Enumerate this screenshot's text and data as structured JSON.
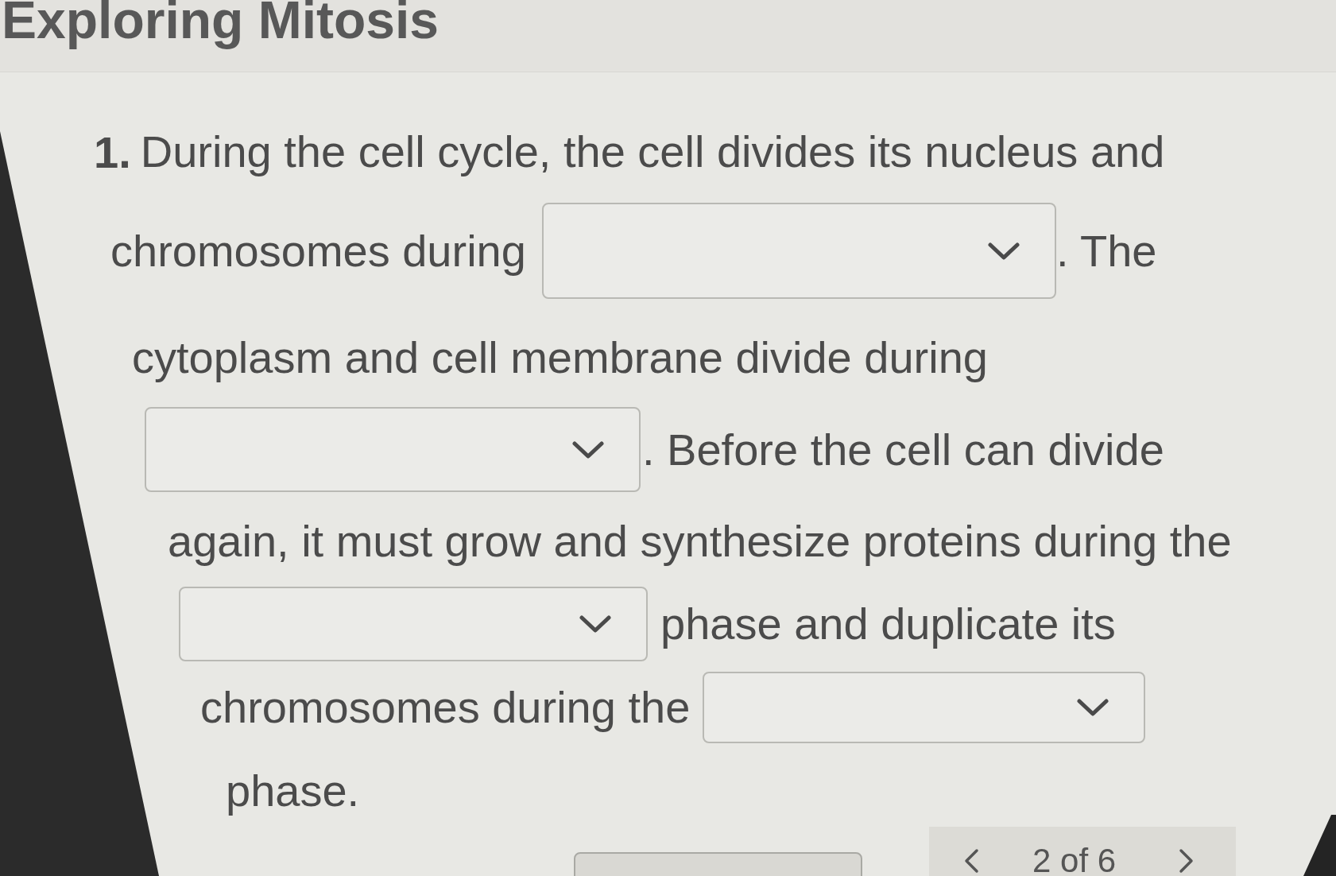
{
  "header": {
    "title": "Exploring Mitosis"
  },
  "question": {
    "number": "1.",
    "lines": [
      [
        {
          "kind": "text",
          "text": "During the cell cycle, the cell divides its nucleus and"
        }
      ],
      [
        {
          "kind": "text",
          "text": "chromosomes during"
        },
        {
          "kind": "dropdown"
        },
        {
          "kind": "text",
          "text": ". The"
        }
      ],
      [
        {
          "kind": "text",
          "text": "cytoplasm and cell membrane divide during"
        }
      ],
      [
        {
          "kind": "dropdown"
        },
        {
          "kind": "text",
          "text": ". Before the cell can divide"
        }
      ],
      [
        {
          "kind": "text",
          "text": "again, it must grow and synthesize proteins during the"
        }
      ],
      [
        {
          "kind": "dropdown"
        },
        {
          "kind": "text",
          "text": "phase and duplicate its"
        }
      ],
      [
        {
          "kind": "text",
          "text": "chromosomes during the"
        },
        {
          "kind": "dropdown"
        }
      ],
      [
        {
          "kind": "text",
          "text": "phase."
        }
      ]
    ]
  },
  "pager": {
    "position": "2 of 6"
  }
}
